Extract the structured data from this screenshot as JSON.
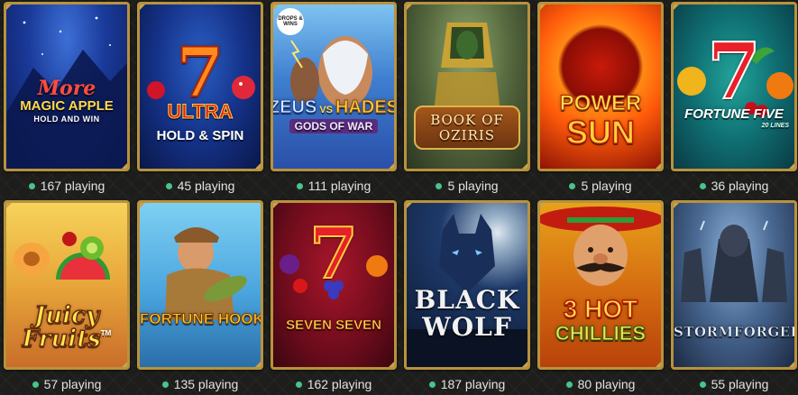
{
  "status_color": "#49c48a",
  "games": [
    {
      "id": "more-magic-apple",
      "logo_lines": [
        "More",
        "MAGIC APPLE",
        "HOLD AND WIN"
      ],
      "players": "167 playing"
    },
    {
      "id": "ultra-hold-spin",
      "logo_lines": [
        "7",
        "ULTRA",
        "HOLD & SPIN"
      ],
      "players": "45 playing"
    },
    {
      "id": "zeus-vs-hades",
      "logo_lines": [
        "DROPS & WINS",
        "ZEUS",
        "VS",
        "HADES",
        "GODS OF WAR"
      ],
      "players": "111 playing"
    },
    {
      "id": "book-of-oziris",
      "logo_lines": [
        "BOOK OF",
        "OZIRIS"
      ],
      "players": "5 playing"
    },
    {
      "id": "power-sun",
      "logo_lines": [
        "POWER",
        "SUN"
      ],
      "players": "5 playing"
    },
    {
      "id": "fortune-five",
      "logo_lines": [
        "7",
        "FORTUNE FIVE",
        "20 LINES"
      ],
      "players": "36 playing"
    },
    {
      "id": "juicy-fruits",
      "logo_lines": [
        "Juicy",
        "Fruits",
        "TM"
      ],
      "players": "57 playing"
    },
    {
      "id": "fortune-hook",
      "logo_lines": [
        "FORTUNE HOOK"
      ],
      "players": "135 playing"
    },
    {
      "id": "seven-seven",
      "logo_lines": [
        "7",
        "SEVEN SEVEN"
      ],
      "players": "162 playing"
    },
    {
      "id": "black-wolf",
      "logo_lines": [
        "BLACK",
        "WOLF"
      ],
      "players": "187 playing"
    },
    {
      "id": "3-hot-chillies",
      "logo_lines": [
        "3 HOT",
        "CHILLIES"
      ],
      "players": "80 playing"
    },
    {
      "id": "stormforged",
      "logo_lines": [
        "STORMFORGED"
      ],
      "players": "55 playing"
    }
  ]
}
